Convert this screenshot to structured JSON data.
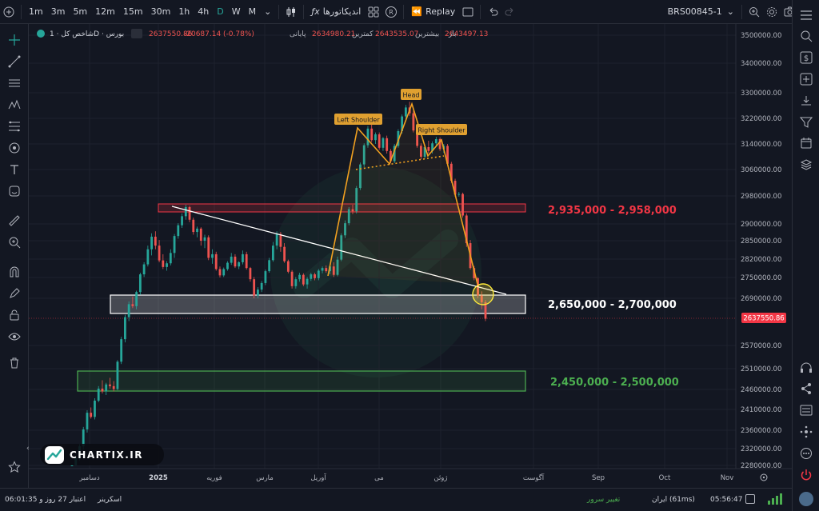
{
  "toolbar": {
    "timeframes": [
      "1m",
      "3m",
      "5m",
      "12m",
      "15m",
      "30m",
      "1h",
      "4h",
      "D",
      "W",
      "M"
    ],
    "active_timeframe": "D",
    "indicators_label": "اندیکاتورها",
    "replay_label": "Replay",
    "symbol": "BRS00845-1"
  },
  "legend": {
    "close_label": "باز",
    "close_value": "2643497.13",
    "high_label": "بیشترین",
    "high_value": "2643535.07",
    "low_label": "کمترین",
    "low_value": "2634980.21",
    "last_label": "پایانی",
    "last_value": "2637550.86",
    "change": "-20687.14 (-0.78%)",
    "symbol_name": "شاخص کل",
    "exchange": "بورس",
    "interval": "1D"
  },
  "price_axis": {
    "ticks": [
      "3500000.00",
      "3400000.00",
      "3300000.00",
      "3220000.00",
      "3140000.00",
      "3060000.00",
      "2980000.00",
      "2900000.00",
      "2850000.00",
      "2820000.00",
      "2750000.00",
      "2690000.00",
      "2570000.00",
      "2510000.00",
      "2460000.00",
      "2410000.00",
      "2360000.00",
      "2320000.00",
      "2280000.00"
    ],
    "current_price": "2637550.86"
  },
  "time_axis": {
    "labels": [
      "دسامبر",
      "2025",
      "فوریه",
      "مارس",
      "آوریل",
      "می",
      "ژوئن",
      "آگوست",
      "Sep",
      "Oct",
      "Nov"
    ]
  },
  "annotations": {
    "left_shoulder": "Left Shoulder",
    "head": "Head",
    "right_shoulder": "Right Shoulder",
    "zone_resistance": "2,935,000 - 2,958,000",
    "zone_support": "2,650,000 - 2,700,000",
    "zone_lower": "2,450,000 - 2,500,000"
  },
  "watermark": {
    "logo_text": "CHARTIX.IR"
  },
  "status": {
    "time": "05:56:47",
    "connection": "ایران (61ms)",
    "server_change": "تغییر سرور",
    "screener": "اسکرینر",
    "credit": "اعتبار 27 روز و 06:01:35"
  },
  "colors": {
    "background": "#131722",
    "up": "#26a69a",
    "down": "#ef5350",
    "resistance": "#f23645",
    "support": "#ffffff",
    "lower_zone": "#4caf50",
    "pattern": "#f0a020",
    "label_bg": "#e0a030",
    "price_label_bg": "#f23645"
  },
  "ohlc_series": [
    [
      2265000,
      2282000,
      2258000,
      2278000
    ],
    [
      2278000,
      2302000,
      2272000,
      2298000
    ],
    [
      2298000,
      2330000,
      2292000,
      2325000
    ],
    [
      2325000,
      2368000,
      2318000,
      2362000
    ],
    [
      2362000,
      2408000,
      2355000,
      2402000
    ],
    [
      2402000,
      2415000,
      2388000,
      2392000
    ],
    [
      2392000,
      2438000,
      2386000,
      2432000
    ],
    [
      2432000,
      2468000,
      2428000,
      2462000
    ],
    [
      2462000,
      2482000,
      2450000,
      2455000
    ],
    [
      2455000,
      2476000,
      2446000,
      2472000
    ],
    [
      2472000,
      2488000,
      2462000,
      2468000
    ],
    [
      2468000,
      2480000,
      2455000,
      2461000
    ],
    [
      2461000,
      2532000,
      2458000,
      2528000
    ],
    [
      2528000,
      2592000,
      2522000,
      2586000
    ],
    [
      2586000,
      2648000,
      2578000,
      2642000
    ],
    [
      2642000,
      2682000,
      2632000,
      2675000
    ],
    [
      2675000,
      2695000,
      2665000,
      2670000
    ],
    [
      2670000,
      2712000,
      2662000,
      2708000
    ],
    [
      2708000,
      2768000,
      2700000,
      2762000
    ],
    [
      2762000,
      2808000,
      2752000,
      2800000
    ],
    [
      2800000,
      2842000,
      2792000,
      2836000
    ],
    [
      2836000,
      2872000,
      2826000,
      2862000
    ],
    [
      2862000,
      2878000,
      2836000,
      2842000
    ],
    [
      2842000,
      2852000,
      2808000,
      2815000
    ],
    [
      2815000,
      2828000,
      2782000,
      2790000
    ],
    [
      2790000,
      2812000,
      2776000,
      2804000
    ],
    [
      2804000,
      2836000,
      2796000,
      2830000
    ],
    [
      2830000,
      2870000,
      2822000,
      2864000
    ],
    [
      2864000,
      2902000,
      2856000,
      2896000
    ],
    [
      2896000,
      2930000,
      2888000,
      2922000
    ],
    [
      2922000,
      2955000,
      2912000,
      2948000
    ],
    [
      2948000,
      2952000,
      2905000,
      2912000
    ],
    [
      2912000,
      2918000,
      2868000,
      2876000
    ],
    [
      2876000,
      2892000,
      2860000,
      2886000
    ],
    [
      2886000,
      2890000,
      2842000,
      2850000
    ],
    [
      2850000,
      2868000,
      2838000,
      2860000
    ],
    [
      2860000,
      2866000,
      2816000,
      2822000
    ],
    [
      2822000,
      2836000,
      2802000,
      2828000
    ],
    [
      2828000,
      2832000,
      2776000,
      2782000
    ],
    [
      2782000,
      2792000,
      2750000,
      2758000
    ],
    [
      2758000,
      2788000,
      2752000,
      2782000
    ],
    [
      2782000,
      2812000,
      2776000,
      2806000
    ],
    [
      2806000,
      2830000,
      2798000,
      2824000
    ],
    [
      2824000,
      2828000,
      2786000,
      2792000
    ],
    [
      2792000,
      2812000,
      2782000,
      2808000
    ],
    [
      2808000,
      2834000,
      2800000,
      2828000
    ],
    [
      2828000,
      2832000,
      2780000,
      2786000
    ],
    [
      2786000,
      2790000,
      2738000,
      2745000
    ],
    [
      2745000,
      2752000,
      2690000,
      2698000
    ],
    [
      2698000,
      2722000,
      2690000,
      2715000
    ],
    [
      2715000,
      2740000,
      2708000,
      2734000
    ],
    [
      2734000,
      2780000,
      2728000,
      2774000
    ],
    [
      2774000,
      2822000,
      2768000,
      2816000
    ],
    [
      2816000,
      2848000,
      2810000,
      2842000
    ],
    [
      2842000,
      2878000,
      2836000,
      2870000
    ],
    [
      2870000,
      2876000,
      2832000,
      2840000
    ],
    [
      2840000,
      2846000,
      2806000,
      2812000
    ],
    [
      2812000,
      2818000,
      2766000,
      2772000
    ],
    [
      2772000,
      2778000,
      2718000,
      2725000
    ],
    [
      2725000,
      2752000,
      2718000,
      2745000
    ],
    [
      2745000,
      2768000,
      2738000,
      2760000
    ],
    [
      2760000,
      2766000,
      2725000,
      2730000
    ],
    [
      2730000,
      2752000,
      2718000,
      2746000
    ],
    [
      2746000,
      2768000,
      2740000,
      2762000
    ],
    [
      2762000,
      2768000,
      2742000,
      2748000
    ],
    [
      2748000,
      2782000,
      2742000,
      2776000
    ],
    [
      2776000,
      2792000,
      2766000,
      2786000
    ],
    [
      2786000,
      2796000,
      2768000,
      2774000
    ],
    [
      2774000,
      2798000,
      2762000,
      2792000
    ],
    [
      2792000,
      2808000,
      2752000,
      2760000
    ],
    [
      2760000,
      2824000,
      2754000,
      2818000
    ],
    [
      2818000,
      2872000,
      2812000,
      2866000
    ],
    [
      2866000,
      2910000,
      2858000,
      2902000
    ],
    [
      2902000,
      2948000,
      2896000,
      2942000
    ],
    [
      2942000,
      2955000,
      2928000,
      2936000
    ],
    [
      2936000,
      3010000,
      2930000,
      3004000
    ],
    [
      3004000,
      3082000,
      2998000,
      3076000
    ],
    [
      3076000,
      3142000,
      3068000,
      3136000
    ],
    [
      3136000,
      3196000,
      3128000,
      3188000
    ],
    [
      3188000,
      3202000,
      3146000,
      3152000
    ],
    [
      3152000,
      3176000,
      3140000,
      3170000
    ],
    [
      3170000,
      3176000,
      3122000,
      3128000
    ],
    [
      3128000,
      3162000,
      3118000,
      3158000
    ],
    [
      3158000,
      3166000,
      3110000,
      3118000
    ],
    [
      3118000,
      3124000,
      3080000,
      3086000
    ],
    [
      3086000,
      3140000,
      3080000,
      3134000
    ],
    [
      3134000,
      3186000,
      3128000,
      3180000
    ],
    [
      3180000,
      3232000,
      3172000,
      3226000
    ],
    [
      3226000,
      3262000,
      3218000,
      3254000
    ],
    [
      3254000,
      3272000,
      3228000,
      3236000
    ],
    [
      3236000,
      3244000,
      3176000,
      3182000
    ],
    [
      3182000,
      3190000,
      3128000,
      3134000
    ],
    [
      3134000,
      3142000,
      3092000,
      3100000
    ],
    [
      3100000,
      3136000,
      3094000,
      3130000
    ],
    [
      3130000,
      3150000,
      3110000,
      3118000
    ],
    [
      3118000,
      3148000,
      3110000,
      3142000
    ],
    [
      3142000,
      3162000,
      3132000,
      3155000
    ],
    [
      3155000,
      3160000,
      3118000,
      3124000
    ],
    [
      3124000,
      3140000,
      3112000,
      3134000
    ],
    [
      3134000,
      3140000,
      3072000,
      3078000
    ],
    [
      3078000,
      3084000,
      3020000,
      3026000
    ],
    [
      3026000,
      3032000,
      2978000,
      2984000
    ],
    [
      2984000,
      2992000,
      2978000,
      2986000
    ],
    [
      2986000,
      2990000,
      2918000,
      2924000
    ],
    [
      2924000,
      2930000,
      2840000,
      2846000
    ],
    [
      2846000,
      2852000,
      2780000,
      2786000
    ],
    [
      2786000,
      2794000,
      2742000,
      2748000
    ],
    [
      2748000,
      2752000,
      2690000,
      2698000
    ],
    [
      2698000,
      2710000,
      2662000,
      2680000
    ],
    [
      2680000,
      2686000,
      2632000,
      2638000
    ]
  ]
}
